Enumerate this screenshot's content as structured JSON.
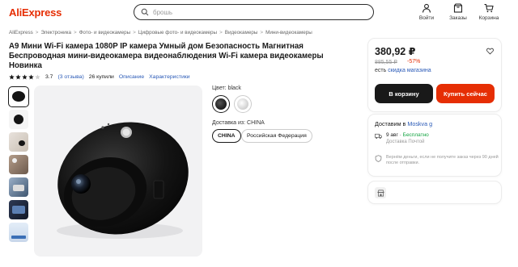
{
  "header": {
    "logo": "AliExpress",
    "search_placeholder": "брошь",
    "login_label": "Войти",
    "orders_label": "Заказы",
    "cart_label": "Корзина",
    "brand_color": "#e62e04"
  },
  "breadcrumbs": [
    "AliExpress",
    "Электроника",
    "Фото- и видеокамеры",
    "Цифровые фото- и видеокамеры",
    "Видеокамеры",
    "Мини-видеокамеры"
  ],
  "product": {
    "title": "A9 Мини Wi-Fi камера 1080P IP камера Умный дом Безопасность Магнитная Беспроводная мини-видеокамера видеонаблюдения Wi-Fi камера видеокамеры Новинка",
    "rating": "3.7",
    "stars_filled": 4,
    "reviews": "(3 отзыва)",
    "bought": "26 купили",
    "description_link": "Описание",
    "specs_link": "Характеристики"
  },
  "options": {
    "color_label": "Цвет: black",
    "swatches": [
      "black",
      "white"
    ],
    "ship_from_label": "Доставка из: CHINA",
    "ship_from": [
      "CHINA",
      "Российская Федерация"
    ]
  },
  "buy": {
    "price": "380,92 ₽",
    "old_price": "885,55 ₽",
    "discount": "-57%",
    "store_text": "есть",
    "store_discount": "скидка магазина",
    "add_to_cart": "В корзину",
    "buy_now": "Купить сейчас"
  },
  "delivery": {
    "title_prefix": "Доставим в",
    "city": "Moskva g",
    "date": "9 авг",
    "free": "Бесплатно",
    "method": "Доставка Почтой",
    "refund": "Вернём деньги, если не получите заказ через 90 дней после отправки."
  }
}
